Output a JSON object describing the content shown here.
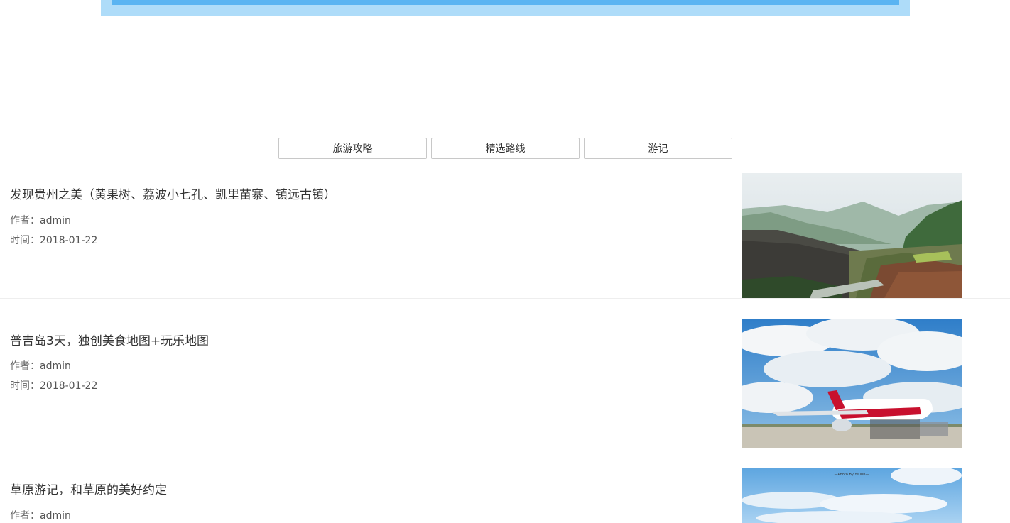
{
  "tabs": [
    {
      "label": "旅游攻略"
    },
    {
      "label": "精选路线"
    },
    {
      "label": "游记"
    }
  ],
  "articles": [
    {
      "title": "发现贵州之美（黄果树、荔波小七孔、凯里苗寨、镇远古镇）",
      "author_label": "作者：",
      "author": "admin",
      "date_label": "时间：",
      "date": "2018-01-22",
      "image": "mountain-village-photo"
    },
    {
      "title": "普吉岛3天，独创美食地图+玩乐地图",
      "author_label": "作者：",
      "author": "admin",
      "date_label": "时间：",
      "date": "2018-01-22",
      "image": "airplane-photo"
    },
    {
      "title": "草原游记，和草原的美好约定",
      "author_label": "作者：",
      "author": "admin",
      "image": "sky-photo",
      "image_caption": "—Photo By Yeuuh—"
    }
  ],
  "colors": {
    "banner_outer": "#aedcf9",
    "banner_inner": "#5ab4f2",
    "divider": "#eeeeee"
  }
}
